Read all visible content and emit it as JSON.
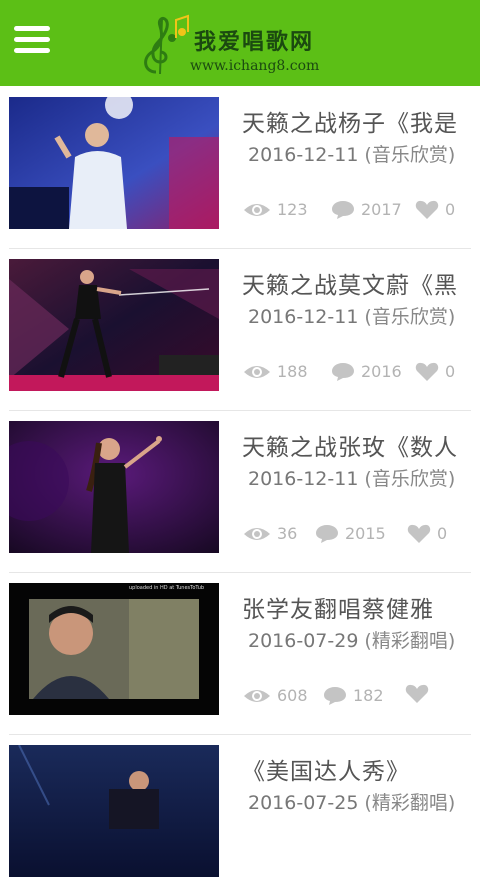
{
  "header": {
    "logo_title": "我爱唱歌网",
    "logo_url": "www.ichang8.com"
  },
  "articles": [
    {
      "title": "天籁之战杨子《我是",
      "date": "2016-12-11",
      "category": "(音乐欣赏)",
      "views": "123",
      "comments": "2017",
      "likes": "0"
    },
    {
      "title": "天籁之战莫文蔚《黑",
      "date": "2016-12-11",
      "category": "(音乐欣赏)",
      "views": "188",
      "comments": "2016",
      "likes": "0"
    },
    {
      "title": "天籁之战张玫《数人",
      "date": "2016-12-11",
      "category": "(音乐欣赏)",
      "views": "36",
      "comments": "2015",
      "likes": "0"
    },
    {
      "title": "张学友翻唱蔡健雅",
      "date": "2016-07-29",
      "category": "(精彩翻唱)",
      "views": "608",
      "comments": "182",
      "likes": "",
      "thumb_caption": "uploaded in HD at TunesToTub"
    },
    {
      "title": "《美国达人秀》",
      "date": "2016-07-25",
      "category": "(精彩翻唱)",
      "views": "",
      "comments": "",
      "likes": ""
    }
  ],
  "colors": {
    "header": "#5cbf16",
    "icon": "#c4c4c4"
  }
}
